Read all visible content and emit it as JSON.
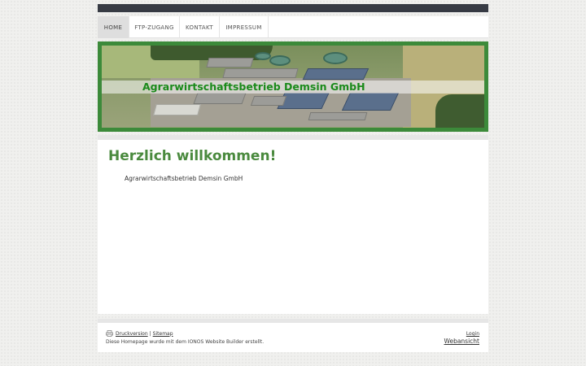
{
  "nav": {
    "items": [
      {
        "label": "HOME",
        "active": true
      },
      {
        "label": "FTP-ZUGANG",
        "active": false
      },
      {
        "label": "KONTAKT",
        "active": false
      },
      {
        "label": "IMPRESSUM",
        "active": false
      }
    ]
  },
  "header": {
    "title": "Agrarwirtschaftsbetrieb Demsin GmbH",
    "accent_color": "#3c8a3a"
  },
  "main": {
    "heading": "Herzlich willkommen!",
    "intro": "Agrarwirtschaftsbetrieb Demsin GmbH"
  },
  "footer": {
    "print_label": "Druckversion",
    "separator": "|",
    "sitemap_label": "Sitemap",
    "note": "Diese Homepage wurde mit dem IONOS Website Builder erstellt.",
    "login_label": "Login",
    "webview_label": "Webansicht",
    "print_icon": "printer-icon"
  }
}
